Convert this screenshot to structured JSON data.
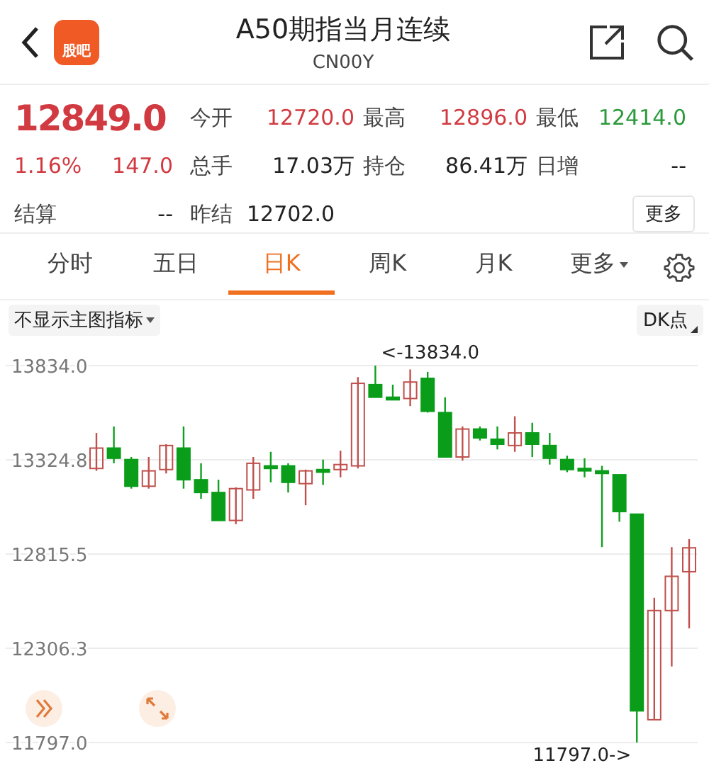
{
  "header": {
    "app_badge": "股吧",
    "title": "A50期指当月连续",
    "code": "CN00Y"
  },
  "quote": {
    "price": "12849.0",
    "change_pct": "1.16%",
    "change": "147.0",
    "color": "#d13a40",
    "stats": [
      {
        "label": "今开",
        "value": "12720.0",
        "color": "#d13a40"
      },
      {
        "label": "最高",
        "value": "12896.0",
        "color": "#d13a40"
      },
      {
        "label": "最低",
        "value": "12414.0",
        "color": "#2a9a3a"
      },
      {
        "label": "总手",
        "value": "17.03万",
        "color": "#222222"
      },
      {
        "label": "持仓",
        "value": "86.41万",
        "color": "#222222"
      },
      {
        "label": "日增",
        "value": "--",
        "color": "#222222"
      }
    ],
    "settle_label": "结算",
    "settle_value": "--",
    "prev_settle": {
      "label": "昨结",
      "value": "12702.0"
    },
    "more_button": "更多"
  },
  "tabs": [
    {
      "label": "分时",
      "selected": false,
      "kind": "plain"
    },
    {
      "label": "五日",
      "selected": false,
      "kind": "plain"
    },
    {
      "label": "日K",
      "selected": true,
      "kind": "plain"
    },
    {
      "label": "周K",
      "selected": false,
      "kind": "plain"
    },
    {
      "label": "月K",
      "selected": false,
      "kind": "plain"
    },
    {
      "label": "更多",
      "selected": false,
      "kind": "dropdown"
    }
  ],
  "toolbar": {
    "indicator": "不显示主图指标",
    "dk": "DK点"
  },
  "chart": {
    "high_marker": "<-13834.0",
    "low_marker": "11797.0->",
    "chart_data": {
      "type": "candlestick",
      "ylim": [
        11797,
        13834
      ],
      "grid": true,
      "yticks": [
        {
          "value": 13834,
          "label": "13834.0"
        },
        {
          "value": 13324.8,
          "label": "13324.8"
        },
        {
          "value": 12815.5,
          "label": "12815.5"
        },
        {
          "value": 12306.3,
          "label": "12306.3"
        },
        {
          "value": 11797,
          "label": "11797.0"
        }
      ],
      "ohlc": [
        [
          13278,
          13470,
          13265,
          13388
        ],
        [
          13388,
          13505,
          13306,
          13333
        ],
        [
          13326,
          13340,
          13169,
          13182
        ],
        [
          13182,
          13340,
          13169,
          13265
        ],
        [
          13272,
          13409,
          13251,
          13402
        ],
        [
          13388,
          13505,
          13169,
          13217
        ],
        [
          13217,
          13306,
          13114,
          13148
        ],
        [
          13148,
          13217,
          12997,
          12997
        ],
        [
          12997,
          13176,
          12977,
          13169
        ],
        [
          13162,
          13340,
          13114,
          13306
        ],
        [
          13292,
          13368,
          13203,
          13278
        ],
        [
          13292,
          13306,
          13148,
          13203
        ],
        [
          13196,
          13272,
          13079,
          13265
        ],
        [
          13272,
          13326,
          13189,
          13258
        ],
        [
          13272,
          13374,
          13230,
          13299
        ],
        [
          13292,
          13772,
          13278,
          13738
        ],
        [
          13731,
          13834,
          13663,
          13663
        ],
        [
          13663,
          13731,
          13649,
          13649
        ],
        [
          13656,
          13813,
          13615,
          13745
        ],
        [
          13765,
          13800,
          13580,
          13587
        ],
        [
          13580,
          13663,
          13340,
          13340
        ],
        [
          13340,
          13505,
          13320,
          13491
        ],
        [
          13491,
          13505,
          13429,
          13443
        ],
        [
          13436,
          13505,
          13381,
          13409
        ],
        [
          13402,
          13560,
          13368,
          13470
        ],
        [
          13470,
          13525,
          13340,
          13409
        ],
        [
          13402,
          13470,
          13299,
          13333
        ],
        [
          13326,
          13347,
          13258,
          13272
        ],
        [
          13278,
          13333,
          13230,
          13265
        ],
        [
          13265,
          13292,
          12853,
          13251
        ],
        [
          13244,
          13244,
          12990,
          13045
        ],
        [
          13031,
          13031,
          11797,
          11968
        ],
        [
          11920,
          12579,
          11920,
          12510
        ],
        [
          12510,
          12853,
          12208,
          12695
        ],
        [
          12720,
          12896,
          12414,
          12849
        ]
      ]
    }
  }
}
